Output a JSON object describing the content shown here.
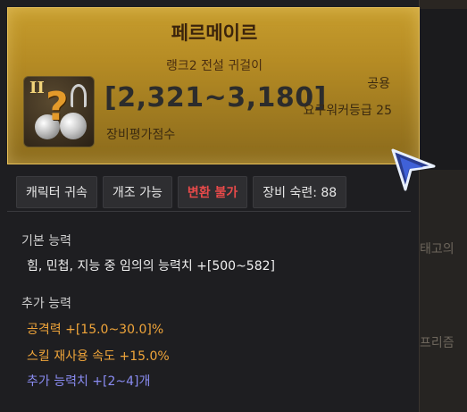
{
  "item": {
    "name": "페르메이르",
    "rank": "랭크2 전설 귀걸이",
    "icon_rank": "II",
    "icon_mark": "?",
    "score": "[2,321~3,180]",
    "score_label": "장비평가점수",
    "usage": "공용",
    "requirement": "요구워커등급 25"
  },
  "tags": [
    {
      "label": "캐릭터 귀속",
      "color": "#e6e6e6"
    },
    {
      "label": "개조 가능",
      "color": "#e6e6e6"
    },
    {
      "label": "변환 불가",
      "color": "#e84a4a"
    },
    {
      "label": "장비 숙련: 88",
      "color": "#e6e6e6"
    }
  ],
  "basic": {
    "title": "기본 능력",
    "lines": [
      "힘, 민첩, 지능 중 임의의 능력치 +[500~582]"
    ]
  },
  "extra": {
    "title": "추가 능력",
    "lines": [
      {
        "text": "공격력  +[15.0~30.0]%",
        "color": "#f0a53a"
      },
      {
        "text": "스킬 재사용 속도  +15.0%",
        "color": "#f0a53a"
      },
      {
        "text": "추가 능력치 +[2~4]개",
        "color": "#8a8cf2"
      }
    ]
  },
  "background": {
    "slot_rank": "II",
    "labels": [
      "태고의",
      "프리즘"
    ]
  },
  "colors": {
    "header_gold": "#c79d2d",
    "tag_red": "#e84a4a",
    "stat_orange": "#f0a53a",
    "stat_blue": "#8a8cf2"
  }
}
